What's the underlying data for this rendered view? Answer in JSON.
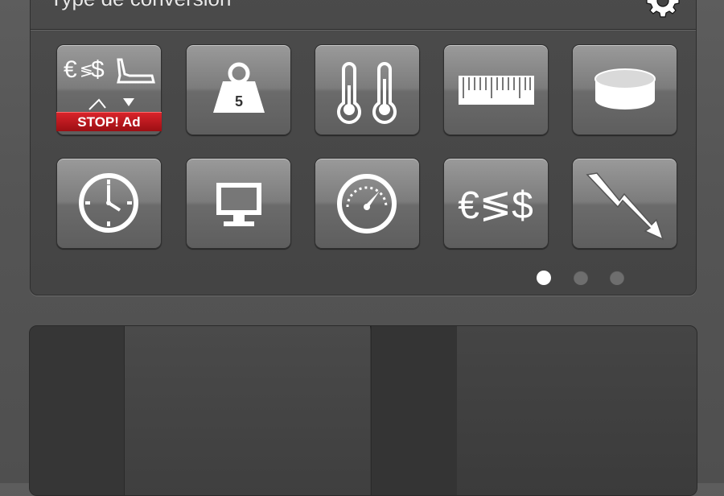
{
  "header": {
    "title": "Type de conversion",
    "settings_icon": "gear-icon"
  },
  "grid": {
    "tiles": [
      {
        "name": "promo-tile",
        "icon": "currency-shoe-icon",
        "badge": "STOP! Ad"
      },
      {
        "name": "weight-tile",
        "icon": "weight-icon",
        "weight_label": "5"
      },
      {
        "name": "temperature-tile",
        "icon": "thermometer-icon"
      },
      {
        "name": "length-tile",
        "icon": "ruler-icon"
      },
      {
        "name": "volume-tile",
        "icon": "cylinder-icon"
      },
      {
        "name": "time-tile",
        "icon": "clock-icon"
      },
      {
        "name": "computer-tile",
        "icon": "monitor-icon"
      },
      {
        "name": "speed-tile",
        "icon": "speedometer-icon"
      },
      {
        "name": "currency-tile",
        "icon": "currency-icon",
        "symbols": "€≶$"
      },
      {
        "name": "electricity-tile",
        "icon": "lightning-icon"
      }
    ]
  },
  "pagination": {
    "pages": 3,
    "current": 1
  },
  "colors": {
    "tile_top": "#9a9a9a",
    "tile_bottom": "#5e5e5e",
    "badge_red": "#c8161d",
    "icon_white": "#ffffff"
  }
}
